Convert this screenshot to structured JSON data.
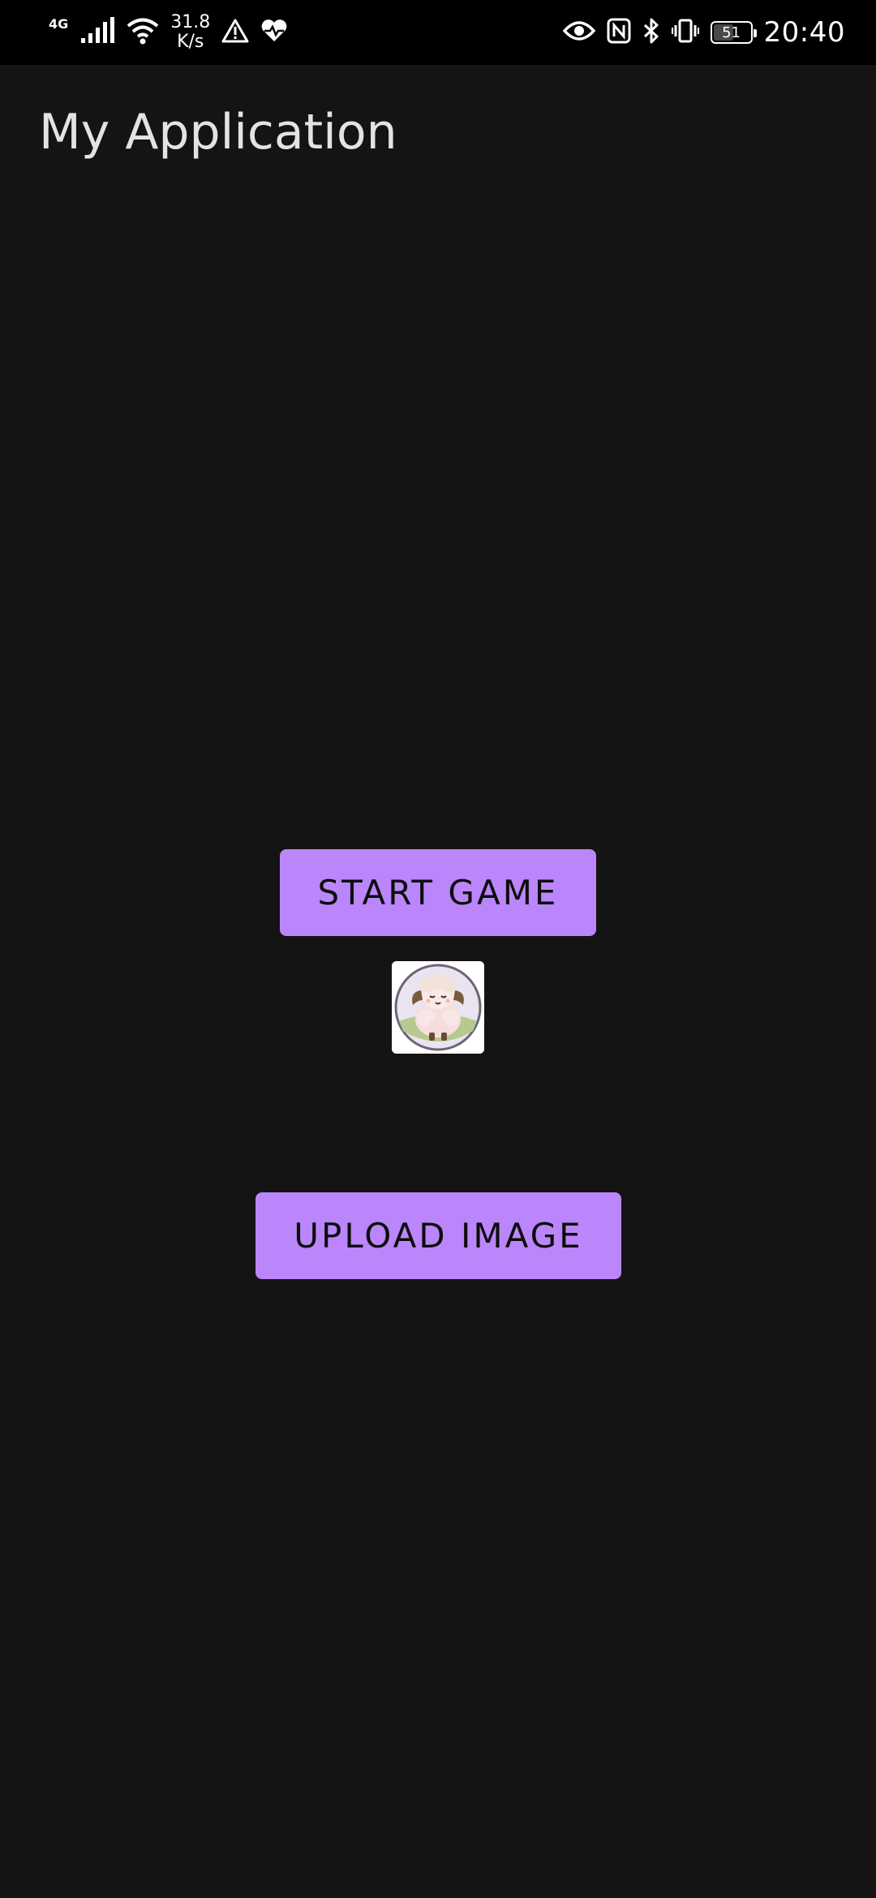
{
  "status_bar": {
    "network_type": "4G",
    "speed_value": "31.8",
    "speed_unit": "K/s",
    "battery_level": "51",
    "time": "20:40",
    "icons": [
      "signal-icon",
      "wifi-icon",
      "warning-icon",
      "heart-health-icon",
      "eye-icon",
      "nfc-icon",
      "bluetooth-icon",
      "vibrate-icon",
      "battery-icon"
    ]
  },
  "app": {
    "title": "My Application"
  },
  "main": {
    "start_button_label": "START GAME",
    "image_icon": "sheep-avatar-icon",
    "upload_button_label": "UPLOAD IMAGE"
  },
  "colors": {
    "background": "#141414",
    "status_bar": "#000000",
    "button": "#bb86fc",
    "button_text": "#0d0d0d",
    "title_text": "#e3e3e3"
  }
}
